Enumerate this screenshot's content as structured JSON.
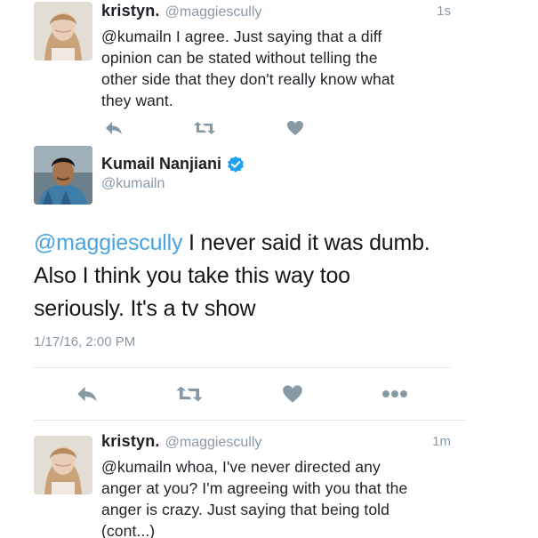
{
  "tweets": [
    {
      "name": "kristyn.",
      "handle": "@maggiescully",
      "time": "1s",
      "lines": [
        "@kumailn I agree. Just saying that a diff",
        "opinion can be stated without telling the",
        "other side that they don't really know what",
        "they want."
      ],
      "actions": [
        "reply-icon",
        "retweet-icon",
        "like-icon"
      ]
    },
    {
      "name": "kristyn.",
      "handle": "@maggiescully",
      "time": "1m",
      "lines": [
        "@kumailn whoa, I've never directed any",
        "anger at you? I'm agreeing with you that the",
        "anger is crazy. Just saying that being told",
        "(cont...)"
      ]
    }
  ],
  "main_tweet": {
    "name": "Kumail Nanjiani",
    "handle": "@kumailn",
    "verified": true,
    "text_mention": "@maggiescully",
    "text_line1_rest": " I never said it was dumb.",
    "text_line2": "Also I think you take this way too",
    "text_line3": "seriously. It's a tv show",
    "date": "1/17/16, 2:00 PM",
    "actions": [
      "reply-icon",
      "retweet-icon",
      "like-icon",
      "more-icon"
    ]
  },
  "colors": {
    "action_icon": "#8899a6",
    "mention": "#4aa3df",
    "verified": "#1da1f2",
    "divider": "#e1e8ed"
  }
}
